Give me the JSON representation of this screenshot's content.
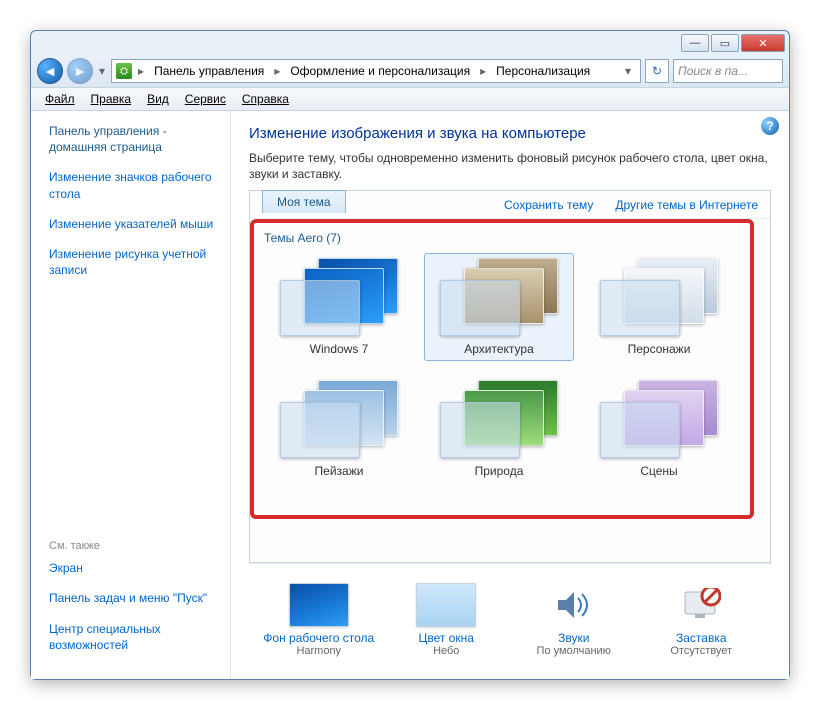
{
  "window": {
    "minimize": "—",
    "maximize": "▭",
    "close": "✕"
  },
  "nav": {
    "back": "◄",
    "forward": "►"
  },
  "breadcrumb": {
    "seg1": "Панель управления",
    "seg2": "Оформление и персонализация",
    "seg3": "Персонализация"
  },
  "toolbar": {
    "refresh": "↻",
    "search_placeholder": "Поиск в па..."
  },
  "menu": {
    "file": "Файл",
    "edit": "Правка",
    "view": "Вид",
    "tools": "Сервис",
    "help": "Справка"
  },
  "sidebar": {
    "home": "Панель управления - домашняя страница",
    "link1": "Изменение значков рабочего стола",
    "link2": "Изменение указателей мыши",
    "link3": "Изменение рисунка учетной записи",
    "seealso_header": "См. также",
    "seealso1": "Экран",
    "seealso2": "Панель задач и меню \"Пуск\"",
    "seealso3": "Центр специальных возможностей"
  },
  "main": {
    "help": "?",
    "title": "Изменение изображения и звука на компьютере",
    "desc": "Выберите тему, чтобы одновременно изменить фоновый рисунок рабочего стола, цвет окна, звуки и заставку.",
    "mytheme": "Моя тема",
    "save_theme": "Сохранить тему",
    "more_themes": "Другие темы в Интернете",
    "group_aero": "Темы Aero (7)",
    "themes": {
      "t1": "Windows 7",
      "t2": "Архитектура",
      "t3": "Персонажи",
      "t4": "Пейзажи",
      "t5": "Природа",
      "t6": "Сцены"
    }
  },
  "bottom": {
    "b1_label": "Фон рабочего стола",
    "b1_value": "Harmony",
    "b2_label": "Цвет окна",
    "b2_value": "Небо",
    "b3_label": "Звуки",
    "b3_value": "По умолчанию",
    "b4_label": "Заставка",
    "b4_value": "Отсутствует"
  }
}
